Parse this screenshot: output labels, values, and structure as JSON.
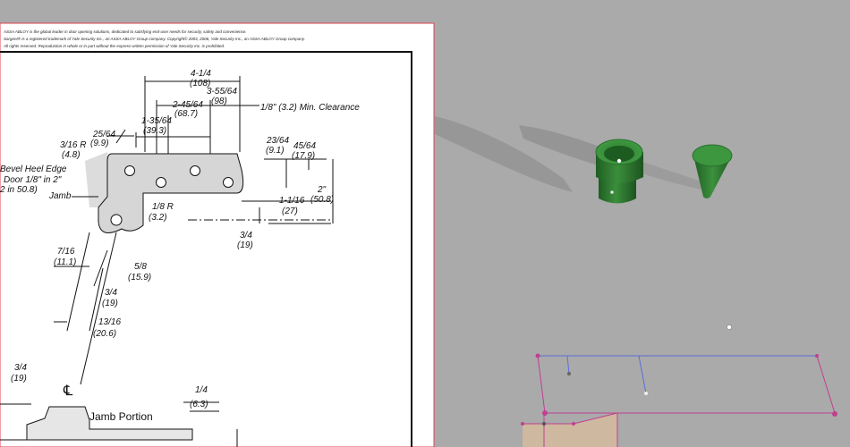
{
  "drawing": {
    "header_lines": [
      "ASSA ABLOY is the global leader in door opening solutions, dedicated to satisfying end-user needs for security, safety and convenience.",
      "Sargent® is a registered trademark of Yale Security Inc., an ASSA ABLOY Group company. Copyright© 2003, 2006, Yale Security Inc., an ASSA ABLOY Group company.",
      "All rights reserved. Reproduction in whole or in part without the express written permission of Yale Security Inc. is prohibited."
    ],
    "dims": {
      "d_4_1_4": "4-1/4",
      "d_108": "(108)",
      "d_3_55_64": "3-55/64",
      "d_98": "(98)",
      "d_2_45_64": "2-45/64",
      "d_68_7": "(68.7)",
      "d_1_35_64": "1-35/64",
      "d_39_3": "(39.3)",
      "clearance": "1/8\" (3.2) Min. Clearance",
      "d_25_64": "25/64",
      "d_9_9": "(9.9)",
      "d_3_16_r": "3/16 R",
      "d_4_8": "(4.8)",
      "d_23_64": "23/64",
      "d_9_1": "(9.1)",
      "d_45_64": "45/64",
      "d_17_9": "(17.9)",
      "bevel_1": "Bevel Heel Edge",
      "bevel_2": "Door 1/8\" in 2\"",
      "bevel_3": "2 in 50.8)",
      "jamb": "Jamb",
      "d_2in": "2\"",
      "d_50_8": "(50.8)",
      "d_1_1_16": "1-1/16",
      "d_27": "(27)",
      "d_1_8_r": "1/8 R",
      "d_3_2": "(3.2)",
      "d_3_4a": "3/4",
      "d_19a": "(19)",
      "d_7_16": "7/16",
      "d_11_1": "(11.1)",
      "d_5_8": "5/8",
      "d_15_9": "(15.9)",
      "d_3_4b": "3/4",
      "d_19b": "(19)",
      "d_13_16": "13/16",
      "d_20_6": "(20.6)",
      "d_3_4c": "3/4",
      "d_19c": "(19)",
      "centerline": "℄",
      "jamb_portion": "Jamb Portion",
      "d_1_4": "1/4",
      "d_6_3": "(6.3)"
    }
  },
  "scene": {
    "objects": [
      "bushing-part",
      "cone-part"
    ],
    "colors": {
      "background": "#aaaaaa",
      "part_green": "#2e7d32",
      "sketch_blue": "#5a6fd8",
      "sketch_magenta": "#c04090",
      "sketch_face": "#d8b898"
    }
  }
}
